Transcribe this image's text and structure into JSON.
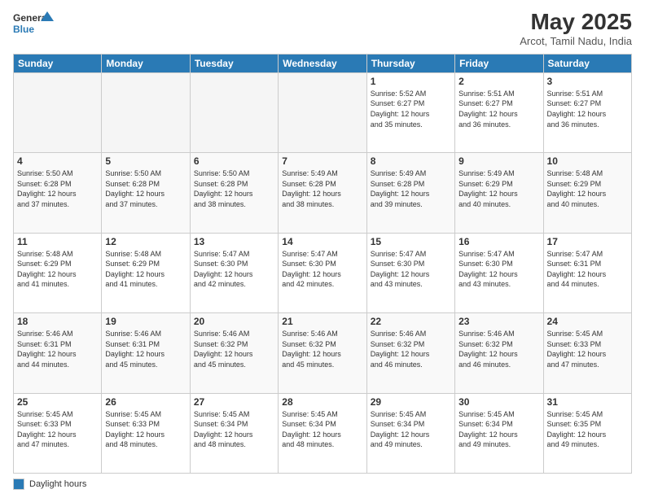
{
  "header": {
    "logo_line1": "General",
    "logo_line2": "Blue",
    "title": "May 2025",
    "subtitle": "Arcot, Tamil Nadu, India"
  },
  "weekdays": [
    "Sunday",
    "Monday",
    "Tuesday",
    "Wednesday",
    "Thursday",
    "Friday",
    "Saturday"
  ],
  "weeks": [
    [
      {
        "day": "",
        "info": ""
      },
      {
        "day": "",
        "info": ""
      },
      {
        "day": "",
        "info": ""
      },
      {
        "day": "",
        "info": ""
      },
      {
        "day": "1",
        "info": "Sunrise: 5:52 AM\nSunset: 6:27 PM\nDaylight: 12 hours\nand 35 minutes."
      },
      {
        "day": "2",
        "info": "Sunrise: 5:51 AM\nSunset: 6:27 PM\nDaylight: 12 hours\nand 36 minutes."
      },
      {
        "day": "3",
        "info": "Sunrise: 5:51 AM\nSunset: 6:27 PM\nDaylight: 12 hours\nand 36 minutes."
      }
    ],
    [
      {
        "day": "4",
        "info": "Sunrise: 5:50 AM\nSunset: 6:28 PM\nDaylight: 12 hours\nand 37 minutes."
      },
      {
        "day": "5",
        "info": "Sunrise: 5:50 AM\nSunset: 6:28 PM\nDaylight: 12 hours\nand 37 minutes."
      },
      {
        "day": "6",
        "info": "Sunrise: 5:50 AM\nSunset: 6:28 PM\nDaylight: 12 hours\nand 38 minutes."
      },
      {
        "day": "7",
        "info": "Sunrise: 5:49 AM\nSunset: 6:28 PM\nDaylight: 12 hours\nand 38 minutes."
      },
      {
        "day": "8",
        "info": "Sunrise: 5:49 AM\nSunset: 6:28 PM\nDaylight: 12 hours\nand 39 minutes."
      },
      {
        "day": "9",
        "info": "Sunrise: 5:49 AM\nSunset: 6:29 PM\nDaylight: 12 hours\nand 40 minutes."
      },
      {
        "day": "10",
        "info": "Sunrise: 5:48 AM\nSunset: 6:29 PM\nDaylight: 12 hours\nand 40 minutes."
      }
    ],
    [
      {
        "day": "11",
        "info": "Sunrise: 5:48 AM\nSunset: 6:29 PM\nDaylight: 12 hours\nand 41 minutes."
      },
      {
        "day": "12",
        "info": "Sunrise: 5:48 AM\nSunset: 6:29 PM\nDaylight: 12 hours\nand 41 minutes."
      },
      {
        "day": "13",
        "info": "Sunrise: 5:47 AM\nSunset: 6:30 PM\nDaylight: 12 hours\nand 42 minutes."
      },
      {
        "day": "14",
        "info": "Sunrise: 5:47 AM\nSunset: 6:30 PM\nDaylight: 12 hours\nand 42 minutes."
      },
      {
        "day": "15",
        "info": "Sunrise: 5:47 AM\nSunset: 6:30 PM\nDaylight: 12 hours\nand 43 minutes."
      },
      {
        "day": "16",
        "info": "Sunrise: 5:47 AM\nSunset: 6:30 PM\nDaylight: 12 hours\nand 43 minutes."
      },
      {
        "day": "17",
        "info": "Sunrise: 5:47 AM\nSunset: 6:31 PM\nDaylight: 12 hours\nand 44 minutes."
      }
    ],
    [
      {
        "day": "18",
        "info": "Sunrise: 5:46 AM\nSunset: 6:31 PM\nDaylight: 12 hours\nand 44 minutes."
      },
      {
        "day": "19",
        "info": "Sunrise: 5:46 AM\nSunset: 6:31 PM\nDaylight: 12 hours\nand 45 minutes."
      },
      {
        "day": "20",
        "info": "Sunrise: 5:46 AM\nSunset: 6:32 PM\nDaylight: 12 hours\nand 45 minutes."
      },
      {
        "day": "21",
        "info": "Sunrise: 5:46 AM\nSunset: 6:32 PM\nDaylight: 12 hours\nand 45 minutes."
      },
      {
        "day": "22",
        "info": "Sunrise: 5:46 AM\nSunset: 6:32 PM\nDaylight: 12 hours\nand 46 minutes."
      },
      {
        "day": "23",
        "info": "Sunrise: 5:46 AM\nSunset: 6:32 PM\nDaylight: 12 hours\nand 46 minutes."
      },
      {
        "day": "24",
        "info": "Sunrise: 5:45 AM\nSunset: 6:33 PM\nDaylight: 12 hours\nand 47 minutes."
      }
    ],
    [
      {
        "day": "25",
        "info": "Sunrise: 5:45 AM\nSunset: 6:33 PM\nDaylight: 12 hours\nand 47 minutes."
      },
      {
        "day": "26",
        "info": "Sunrise: 5:45 AM\nSunset: 6:33 PM\nDaylight: 12 hours\nand 48 minutes."
      },
      {
        "day": "27",
        "info": "Sunrise: 5:45 AM\nSunset: 6:34 PM\nDaylight: 12 hours\nand 48 minutes."
      },
      {
        "day": "28",
        "info": "Sunrise: 5:45 AM\nSunset: 6:34 PM\nDaylight: 12 hours\nand 48 minutes."
      },
      {
        "day": "29",
        "info": "Sunrise: 5:45 AM\nSunset: 6:34 PM\nDaylight: 12 hours\nand 49 minutes."
      },
      {
        "day": "30",
        "info": "Sunrise: 5:45 AM\nSunset: 6:34 PM\nDaylight: 12 hours\nand 49 minutes."
      },
      {
        "day": "31",
        "info": "Sunrise: 5:45 AM\nSunset: 6:35 PM\nDaylight: 12 hours\nand 49 minutes."
      }
    ]
  ],
  "footer": {
    "legend_label": "Daylight hours"
  }
}
